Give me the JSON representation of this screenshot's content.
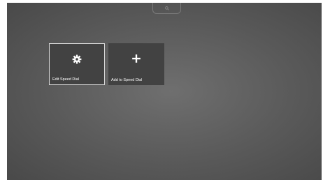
{
  "speed_dial": {
    "search_tab_icon": "search-icon",
    "tiles": [
      {
        "icon": "gear-icon",
        "label": "Edit Speed Dial"
      },
      {
        "icon": "plus-icon",
        "label": "Add to Speed Dial"
      }
    ]
  },
  "colors": {
    "background_center": "#6f6f6f",
    "background_edge": "#4a4a4a",
    "tile_background": "#424242",
    "tile_focus_border": "#d9d9d9",
    "text": "#ffffff"
  }
}
